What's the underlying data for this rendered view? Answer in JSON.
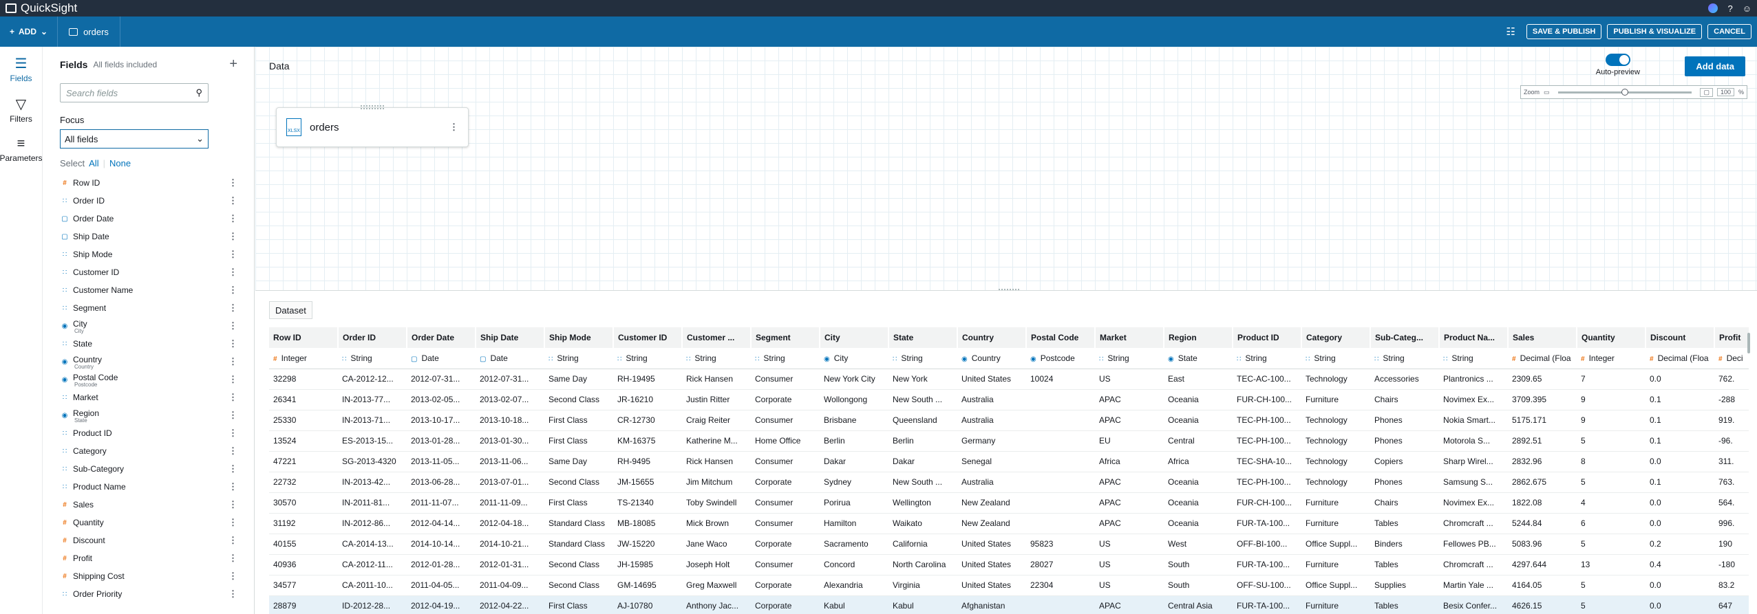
{
  "topbar": {
    "app_name": "QuickSight"
  },
  "toolbar": {
    "add_label": "ADD",
    "dataset_name": "orders",
    "buttons": [
      "SAVE & PUBLISH",
      "PUBLISH & VISUALIZE",
      "CANCEL"
    ]
  },
  "rail": {
    "items": [
      {
        "label": "Fields",
        "icon": "fields-icon"
      },
      {
        "label": "Filters",
        "icon": "filter-icon"
      },
      {
        "label": "Parameters",
        "icon": "parameters-icon"
      }
    ]
  },
  "fields_panel": {
    "title": "Fields",
    "subtitle": "All fields included",
    "search_placeholder": "Search fields",
    "focus_label": "Focus",
    "focus_value": "All fields",
    "select_label": "Select",
    "select_all": "All",
    "select_none": "None",
    "fields": [
      {
        "name": "Row ID",
        "kind": "num"
      },
      {
        "name": "Order ID",
        "kind": "str"
      },
      {
        "name": "Order Date",
        "kind": "date"
      },
      {
        "name": "Ship Date",
        "kind": "date"
      },
      {
        "name": "Ship Mode",
        "kind": "str"
      },
      {
        "name": "Customer ID",
        "kind": "str"
      },
      {
        "name": "Customer Name",
        "kind": "str"
      },
      {
        "name": "Segment",
        "kind": "str"
      },
      {
        "name": "City",
        "kind": "geo",
        "sub": "City"
      },
      {
        "name": "State",
        "kind": "str"
      },
      {
        "name": "Country",
        "kind": "geo",
        "sub": "Country"
      },
      {
        "name": "Postal Code",
        "kind": "geo",
        "sub": "Postcode"
      },
      {
        "name": "Market",
        "kind": "str"
      },
      {
        "name": "Region",
        "kind": "geo",
        "sub": "State"
      },
      {
        "name": "Product ID",
        "kind": "str"
      },
      {
        "name": "Category",
        "kind": "str"
      },
      {
        "name": "Sub-Category",
        "kind": "str"
      },
      {
        "name": "Product Name",
        "kind": "str"
      },
      {
        "name": "Sales",
        "kind": "num"
      },
      {
        "name": "Quantity",
        "kind": "num"
      },
      {
        "name": "Discount",
        "kind": "num"
      },
      {
        "name": "Profit",
        "kind": "num"
      },
      {
        "name": "Shipping Cost",
        "kind": "num"
      },
      {
        "name": "Order Priority",
        "kind": "str"
      }
    ]
  },
  "data_area": {
    "title": "Data",
    "auto_preview_label": "Auto-preview",
    "add_data_label": "Add data",
    "zoom_label": "Zoom",
    "zoom_value": "100",
    "zoom_unit": "%",
    "zoom_level_fraction": 0.5,
    "node_name": "orders",
    "node_type": "XLSX"
  },
  "dataset": {
    "tab_label": "Dataset",
    "columns": [
      {
        "name": "Row ID",
        "type": "Integer",
        "kind": "num"
      },
      {
        "name": "Order ID",
        "type": "String",
        "kind": "str"
      },
      {
        "name": "Order Date",
        "type": "Date",
        "kind": "date"
      },
      {
        "name": "Ship Date",
        "type": "Date",
        "kind": "date"
      },
      {
        "name": "Ship Mode",
        "type": "String",
        "kind": "str"
      },
      {
        "name": "Customer ID",
        "type": "String",
        "kind": "str"
      },
      {
        "name": "Customer ...",
        "type": "String",
        "kind": "str"
      },
      {
        "name": "Segment",
        "type": "String",
        "kind": "str"
      },
      {
        "name": "City",
        "type": "City",
        "kind": "geo"
      },
      {
        "name": "State",
        "type": "String",
        "kind": "str"
      },
      {
        "name": "Country",
        "type": "Country",
        "kind": "geo"
      },
      {
        "name": "Postal Code",
        "type": "Postcode",
        "kind": "geo"
      },
      {
        "name": "Market",
        "type": "String",
        "kind": "str"
      },
      {
        "name": "Region",
        "type": "State",
        "kind": "geo"
      },
      {
        "name": "Product ID",
        "type": "String",
        "kind": "str"
      },
      {
        "name": "Category",
        "type": "String",
        "kind": "str"
      },
      {
        "name": "Sub-Categ...",
        "type": "String",
        "kind": "str"
      },
      {
        "name": "Product Na...",
        "type": "String",
        "kind": "str"
      },
      {
        "name": "Sales",
        "type": "Decimal (Floa",
        "kind": "num"
      },
      {
        "name": "Quantity",
        "type": "Integer",
        "kind": "num"
      },
      {
        "name": "Discount",
        "type": "Decimal (Floa",
        "kind": "num"
      },
      {
        "name": "Profit",
        "type": "Deci",
        "kind": "num"
      }
    ],
    "rows": [
      [
        "32298",
        "CA-2012-12...",
        "2012-07-31...",
        "2012-07-31...",
        "Same Day",
        "RH-19495",
        "Rick Hansen",
        "Consumer",
        "New York City",
        "New York",
        "United States",
        "10024",
        "US",
        "East",
        "TEC-AC-100...",
        "Technology",
        "Accessories",
        "Plantronics ...",
        "2309.65",
        "7",
        "0.0",
        "762."
      ],
      [
        "26341",
        "IN-2013-77...",
        "2013-02-05...",
        "2013-02-07...",
        "Second Class",
        "JR-16210",
        "Justin Ritter",
        "Corporate",
        "Wollongong",
        "New South ...",
        "Australia",
        "",
        "APAC",
        "Oceania",
        "FUR-CH-100...",
        "Furniture",
        "Chairs",
        "Novimex Ex...",
        "3709.395",
        "9",
        "0.1",
        "-288"
      ],
      [
        "25330",
        "IN-2013-71...",
        "2013-10-17...",
        "2013-10-18...",
        "First Class",
        "CR-12730",
        "Craig Reiter",
        "Consumer",
        "Brisbane",
        "Queensland",
        "Australia",
        "",
        "APAC",
        "Oceania",
        "TEC-PH-100...",
        "Technology",
        "Phones",
        "Nokia Smart...",
        "5175.171",
        "9",
        "0.1",
        "919."
      ],
      [
        "13524",
        "ES-2013-15...",
        "2013-01-28...",
        "2013-01-30...",
        "First Class",
        "KM-16375",
        "Katherine M...",
        "Home Office",
        "Berlin",
        "Berlin",
        "Germany",
        "",
        "EU",
        "Central",
        "TEC-PH-100...",
        "Technology",
        "Phones",
        "Motorola S...",
        "2892.51",
        "5",
        "0.1",
        "-96."
      ],
      [
        "47221",
        "SG-2013-4320",
        "2013-11-05...",
        "2013-11-06...",
        "Same Day",
        "RH-9495",
        "Rick Hansen",
        "Consumer",
        "Dakar",
        "Dakar",
        "Senegal",
        "",
        "Africa",
        "Africa",
        "TEC-SHA-10...",
        "Technology",
        "Copiers",
        "Sharp Wirel...",
        "2832.96",
        "8",
        "0.0",
        "311."
      ],
      [
        "22732",
        "IN-2013-42...",
        "2013-06-28...",
        "2013-07-01...",
        "Second Class",
        "JM-15655",
        "Jim Mitchum",
        "Corporate",
        "Sydney",
        "New South ...",
        "Australia",
        "",
        "APAC",
        "Oceania",
        "TEC-PH-100...",
        "Technology",
        "Phones",
        "Samsung S...",
        "2862.675",
        "5",
        "0.1",
        "763."
      ],
      [
        "30570",
        "IN-2011-81...",
        "2011-11-07...",
        "2011-11-09...",
        "First Class",
        "TS-21340",
        "Toby Swindell",
        "Consumer",
        "Porirua",
        "Wellington",
        "New Zealand",
        "",
        "APAC",
        "Oceania",
        "FUR-CH-100...",
        "Furniture",
        "Chairs",
        "Novimex Ex...",
        "1822.08",
        "4",
        "0.0",
        "564."
      ],
      [
        "31192",
        "IN-2012-86...",
        "2012-04-14...",
        "2012-04-18...",
        "Standard Class",
        "MB-18085",
        "Mick Brown",
        "Consumer",
        "Hamilton",
        "Waikato",
        "New Zealand",
        "",
        "APAC",
        "Oceania",
        "FUR-TA-100...",
        "Furniture",
        "Tables",
        "Chromcraft ...",
        "5244.84",
        "6",
        "0.0",
        "996."
      ],
      [
        "40155",
        "CA-2014-13...",
        "2014-10-14...",
        "2014-10-21...",
        "Standard Class",
        "JW-15220",
        "Jane Waco",
        "Corporate",
        "Sacramento",
        "California",
        "United States",
        "95823",
        "US",
        "West",
        "OFF-BI-100...",
        "Office Suppl...",
        "Binders",
        "Fellowes PB...",
        "5083.96",
        "5",
        "0.2",
        "190"
      ],
      [
        "40936",
        "CA-2012-11...",
        "2012-01-28...",
        "2012-01-31...",
        "Second Class",
        "JH-15985",
        "Joseph Holt",
        "Consumer",
        "Concord",
        "North Carolina",
        "United States",
        "28027",
        "US",
        "South",
        "FUR-TA-100...",
        "Furniture",
        "Tables",
        "Chromcraft ...",
        "4297.644",
        "13",
        "0.4",
        "-180"
      ],
      [
        "34577",
        "CA-2011-10...",
        "2011-04-05...",
        "2011-04-09...",
        "Second Class",
        "GM-14695",
        "Greg Maxwell",
        "Corporate",
        "Alexandria",
        "Virginia",
        "United States",
        "22304",
        "US",
        "South",
        "OFF-SU-100...",
        "Office Suppl...",
        "Supplies",
        "Martin Yale ...",
        "4164.05",
        "5",
        "0.0",
        "83.2"
      ],
      [
        "28879",
        "ID-2012-28...",
        "2012-04-19...",
        "2012-04-22...",
        "First Class",
        "AJ-10780",
        "Anthony Jac...",
        "Corporate",
        "Kabul",
        "Kabul",
        "Afghanistan",
        "",
        "APAC",
        "Central Asia",
        "FUR-TA-100...",
        "Furniture",
        "Tables",
        "Besix Confer...",
        "4626.15",
        "5",
        "0.0",
        "647"
      ]
    ],
    "selected_row": 11
  }
}
